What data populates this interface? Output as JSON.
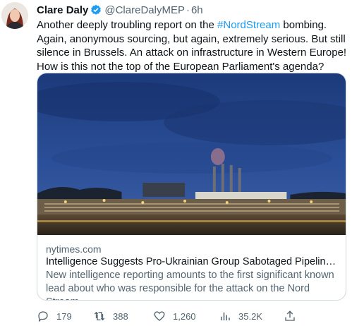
{
  "author": {
    "name": "Clare Daly",
    "handle": "@ClareDalyMEP",
    "separator": "·",
    "time": "6h"
  },
  "tweet": {
    "text_before": "Another deeply troubling report on the ",
    "hashtag": "#NordStream",
    "text_after": " bombing. Again, anonymous sourcing, but again, extremely serious. But still silence in Brussels. An attack on infrastructure in Western Europe! How is this not the top of the European Parliament's agenda?"
  },
  "card": {
    "domain": "nytimes.com",
    "title": "Intelligence Suggests Pro-Ukrainian Group Sabotaged Pipelines, U...",
    "description": "New intelligence reporting amounts to the first significant known lead about who was responsible for the attack on the Nord Stream..."
  },
  "actions": {
    "replies": "179",
    "retweets": "388",
    "likes": "1,260",
    "views": "35.2K"
  },
  "icons": [
    "verified-badge-icon",
    "reply-icon",
    "retweet-icon",
    "like-icon",
    "views-icon",
    "share-icon"
  ],
  "colors": {
    "accent": "#1d9bf0",
    "secondary_text": "#536471",
    "primary_text": "#0f1419"
  }
}
